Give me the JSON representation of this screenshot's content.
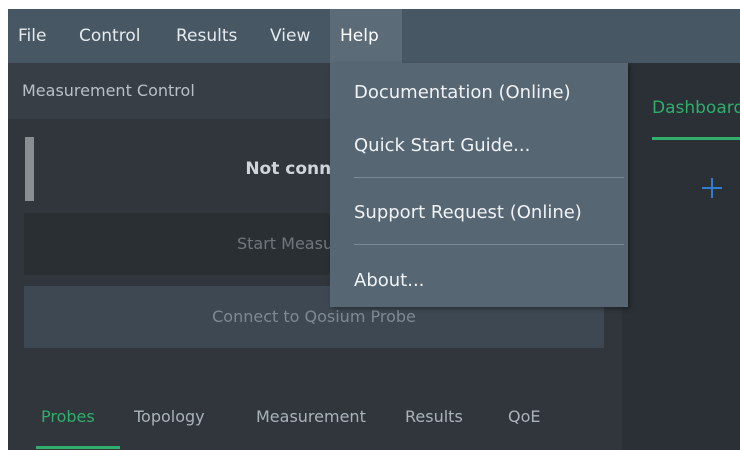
{
  "menubar": {
    "items": [
      {
        "label": "File"
      },
      {
        "label": "Control"
      },
      {
        "label": "Results"
      },
      {
        "label": "View"
      },
      {
        "label": "Help"
      }
    ],
    "active": "Help"
  },
  "left_panel": {
    "title": "Measurement Control",
    "status": "Not connected",
    "start_button": "Start Measurement",
    "connect_button": "Connect to Qosium Probe",
    "tabs": [
      {
        "label": "Probes"
      },
      {
        "label": "Topology"
      },
      {
        "label": "Measurement"
      },
      {
        "label": "Results"
      },
      {
        "label": "QoE"
      }
    ],
    "active_tab": "Probes"
  },
  "right_panel": {
    "tab_label": "Dashboard"
  },
  "help_menu": {
    "items": [
      {
        "label": "Documentation (Online)"
      },
      {
        "label": "Quick Start Guide..."
      },
      {
        "label": "Support Request (Online)"
      },
      {
        "label": "About..."
      }
    ]
  },
  "colors": {
    "accent_green": "#2fae6c",
    "accent_blue": "#2f7fd0",
    "menubar": "#475763",
    "dropdown": "#576673"
  }
}
